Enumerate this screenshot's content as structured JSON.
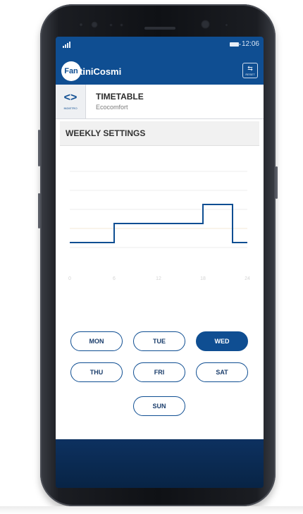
{
  "status_bar": {
    "time": "12:06"
  },
  "header": {
    "logo_mark": "Fan",
    "logo_text": "tiniCosmi",
    "reset_label": "RESET"
  },
  "sub_header": {
    "back_label": "INDIETRO",
    "title": "TIMETABLE",
    "subtitle": "Ecocomfort"
  },
  "section": {
    "title": "WEEKLY SETTINGS"
  },
  "days": [
    {
      "label": "MON",
      "active": false
    },
    {
      "label": "TUE",
      "active": false
    },
    {
      "label": "WED",
      "active": true
    },
    {
      "label": "THU",
      "active": false
    },
    {
      "label": "FRI",
      "active": false
    },
    {
      "label": "SAT",
      "active": false
    },
    {
      "label": "SUN",
      "active": false
    }
  ],
  "chart_data": {
    "type": "line",
    "x_ticks": [
      "0",
      "6",
      "12",
      "18",
      "24"
    ],
    "xlim": [
      0,
      24
    ],
    "levels": 4,
    "series": [
      {
        "x": [
          0,
          6,
          6,
          18,
          18,
          22,
          22,
          24
        ],
        "y": [
          1,
          1,
          2,
          2,
          3,
          3,
          1,
          1
        ]
      }
    ],
    "color": "#0f4e92",
    "grid": true
  },
  "colors": {
    "accent": "#0f4e92",
    "screen_bg": "#0b2a4f"
  }
}
